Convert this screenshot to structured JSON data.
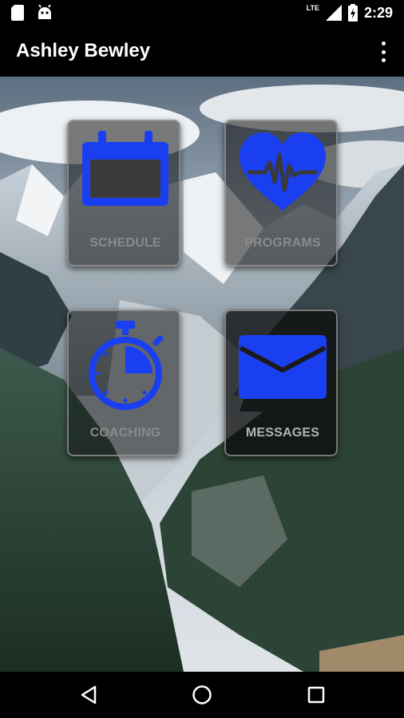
{
  "status_bar": {
    "time": "2:29",
    "network": "LTE",
    "icons": [
      "sd-card-icon",
      "android-icon",
      "signal-icon",
      "battery-icon"
    ]
  },
  "app_bar": {
    "title": "Ashley Bewley",
    "menu_icon": "overflow-menu-icon"
  },
  "tiles": [
    {
      "label": "SCHEDULE",
      "icon": "calendar-icon"
    },
    {
      "label": "PROGRAMS",
      "icon": "heart-rate-icon"
    },
    {
      "label": "COACHING",
      "icon": "stopwatch-icon"
    },
    {
      "label": "MESSAGES",
      "icon": "mail-icon"
    }
  ],
  "colors": {
    "accent": "#1a3ff0",
    "tile_label": "#8a8a8a",
    "bars": "#000000"
  },
  "nav_bar": {
    "icons": [
      "back-icon",
      "home-icon",
      "recents-icon"
    ]
  }
}
